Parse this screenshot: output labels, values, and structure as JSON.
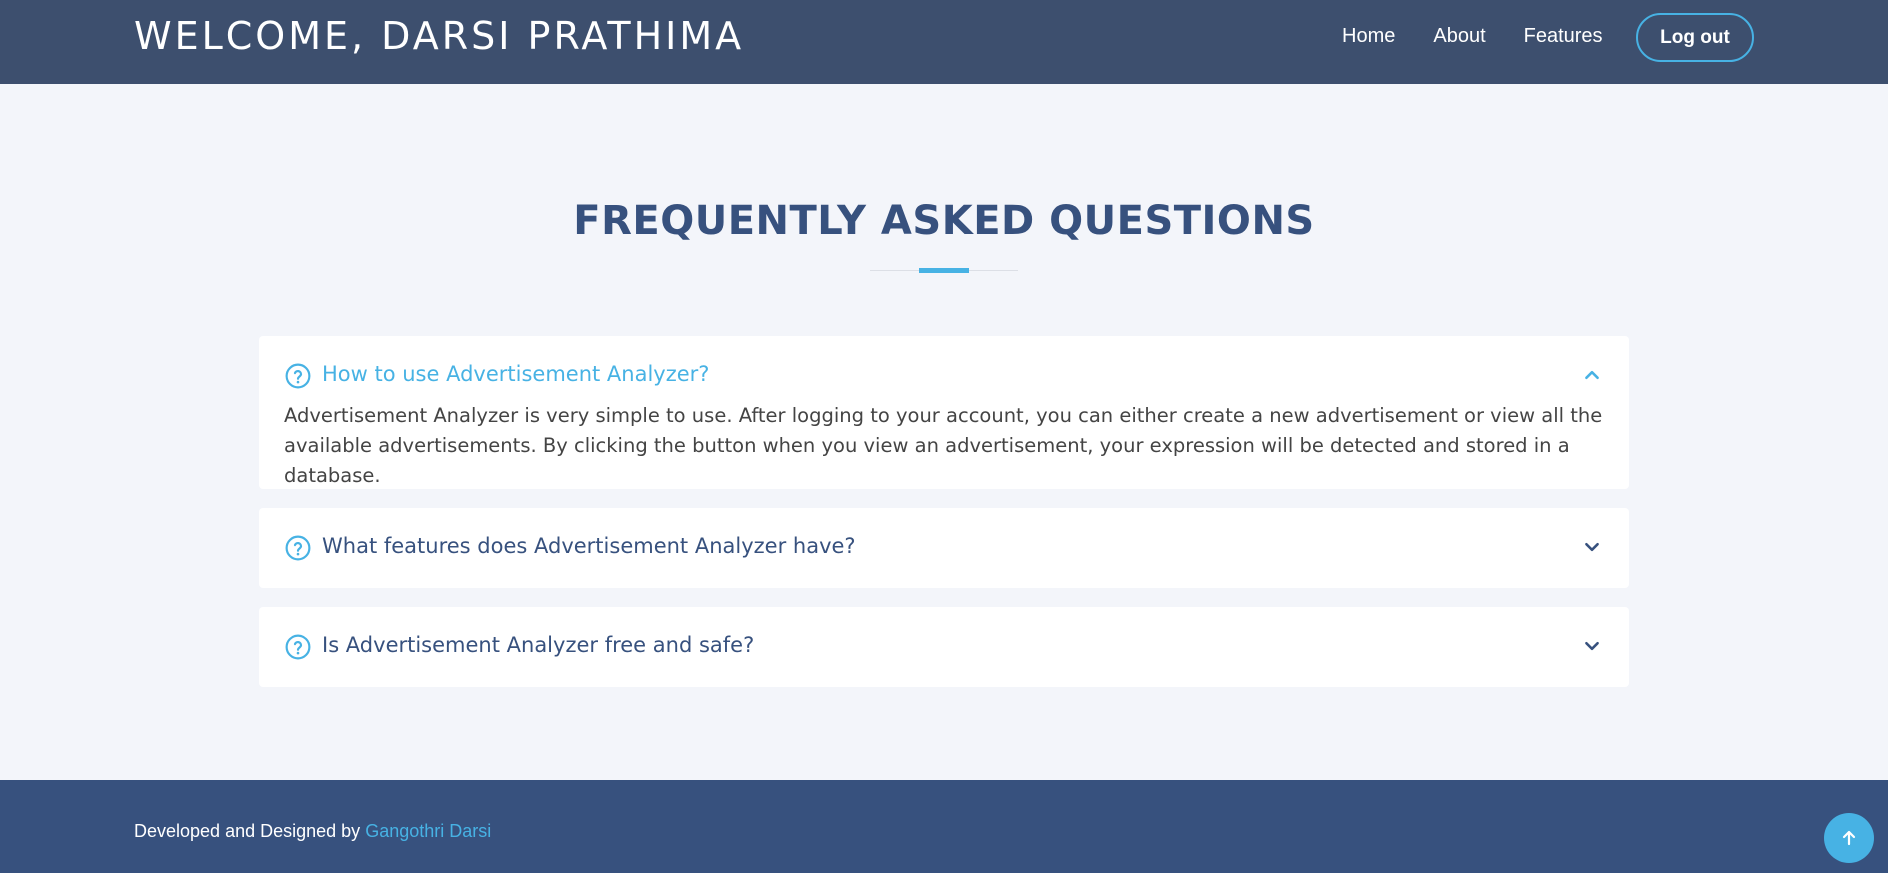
{
  "header": {
    "title": "WELCOME, DARSI PRATHIMA",
    "nav": [
      {
        "label": "Home"
      },
      {
        "label": "About"
      },
      {
        "label": "Features"
      }
    ],
    "logout_label": "Log out"
  },
  "faq": {
    "title": "FREQUENTLY ASKED QUESTIONS",
    "items": [
      {
        "question": "How to use Advertisement Analyzer?",
        "answer": "Advertisement Analyzer is very simple to use. After logging to your account, you can either create a new advertisement or view all the available advertisements. By clicking the button when you view an advertisement, your expression will be detected and stored in a database.",
        "expanded": true,
        "icon": "chevron-up-icon"
      },
      {
        "question": "What features does Advertisement Analyzer have?",
        "expanded": false,
        "icon": "chevron-down-icon"
      },
      {
        "question": "Is Advertisement Analyzer free and safe?",
        "expanded": false,
        "icon": "chevron-down-icon"
      }
    ]
  },
  "footer": {
    "text": "Developed and Designed by",
    "author": "Gangothri Darsi"
  },
  "colors": {
    "header_bg": "#3d4f6e",
    "primary": "#37517e",
    "accent": "#47b2e4",
    "page_bg": "#f3f5fa"
  },
  "icons": {
    "question": "help-circle-icon",
    "back_to_top": "arrow-up-icon"
  }
}
